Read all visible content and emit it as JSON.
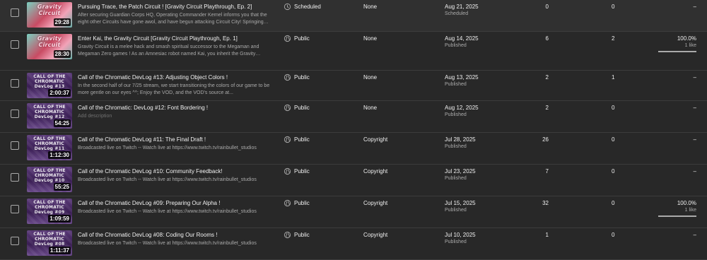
{
  "rows": [
    {
      "thumb_style": "gravity",
      "thumb_text": "Gravity Circuit",
      "duration": "29:28",
      "title": "Pursuing Trace, the Patch Circuit ! [Gravity Circuit Playthrough, Ep. 2]",
      "description": "After securing Guardian Corps HQ, Operating Commander Kernel informs you that the eight other Circuits have gone awol, and have begun attacking Circuit City! Springing into action,...",
      "visibility": "Scheduled",
      "visibility_icon": "clock-icon",
      "restrictions": "None",
      "date": "Aug 21, 2025",
      "date_status": "Scheduled",
      "views": "0",
      "comments": "0",
      "likes": "–",
      "likes_sub": "",
      "like_ratio": null
    },
    {
      "thumb_style": "gravity",
      "thumb_text": "Gravity Circuit",
      "duration": "28:30",
      "title": "Enter Kai, the Gravity Circuit [Gravity Circuit Playthrough, Ep. 1]",
      "description": "Gravity Circuit is a melee hack and smash spiritual successor to the Megaman and Megaman Zero games ! As an Amnesiac robot named Kai, you inherit the Gravity Circuit an...",
      "visibility": "Public",
      "visibility_icon": "globe-icon",
      "restrictions": "None",
      "date": "Aug 14, 2025",
      "date_status": "Published",
      "views": "6",
      "comments": "2",
      "likes": "100.0%",
      "likes_sub": "1 like",
      "like_ratio": 1.0
    },
    {
      "thumb_style": "chromatic",
      "thumb_text": "CALL OF THE CHROMATIC DevLog #13",
      "duration": "2:00:37",
      "title": "Call of the Chromatic DevLog #13: Adjusting Object Colors !",
      "description": "In the second half of our 7/25 stream, we start transitioning the colors of our game to be more gentle on our eyes ^^; Enjoy the VOD, and the VOD's source at...",
      "visibility": "Public",
      "visibility_icon": "globe-icon",
      "restrictions": "None",
      "date": "Aug 13, 2025",
      "date_status": "Published",
      "views": "2",
      "comments": "1",
      "likes": "–",
      "likes_sub": "",
      "like_ratio": null
    },
    {
      "thumb_style": "chromatic",
      "thumb_text": "CALL OF THE CHROMATIC DevLog #12",
      "duration": "54:25",
      "title": "Call of the Chromatic: DevLog #12: Font Bordering !",
      "description": "Add description",
      "description_placeholder": true,
      "visibility": "Public",
      "visibility_icon": "globe-icon",
      "restrictions": "None",
      "date": "Aug 12, 2025",
      "date_status": "Published",
      "views": "2",
      "comments": "0",
      "likes": "–",
      "likes_sub": "",
      "like_ratio": null
    },
    {
      "thumb_style": "chromatic",
      "thumb_text": "CALL OF THE CHROMATIC DevLog #11",
      "duration": "1:12:30",
      "title": "Call of the Chromatic DevLog #11: The Final Draft !",
      "description": "Broadcasted live on Twitch -- Watch live at https://www.twitch.tv/rainbullet_studios",
      "visibility": "Public",
      "visibility_icon": "globe-icon",
      "restrictions": "Copyright",
      "date": "Jul 28, 2025",
      "date_status": "Published",
      "views": "26",
      "comments": "0",
      "likes": "–",
      "likes_sub": "",
      "like_ratio": null
    },
    {
      "thumb_style": "chromatic",
      "thumb_text": "CALL OF THE CHROMATIC DevLog #10",
      "duration": "55:25",
      "title": "Call of the Chromatic DevLog #10: Community Feedback!",
      "description": "Broadcasted live on Twitch -- Watch live at https://www.twitch.tv/rainbullet_studios",
      "visibility": "Public",
      "visibility_icon": "globe-icon",
      "restrictions": "Copyright",
      "date": "Jul 23, 2025",
      "date_status": "Published",
      "views": "7",
      "comments": "0",
      "likes": "–",
      "likes_sub": "",
      "like_ratio": null
    },
    {
      "thumb_style": "chromatic",
      "thumb_text": "CALL OF THE CHROMATIC DevLog #09",
      "duration": "1:09:59",
      "title": "Call of the Chromatic DevLog #09: Preparing Our Alpha !",
      "description": "Broadcasted live on Twitch -- Watch live at https://www.twitch.tv/rainbullet_studios",
      "visibility": "Public",
      "visibility_icon": "globe-icon",
      "restrictions": "Copyright",
      "date": "Jul 15, 2025",
      "date_status": "Published",
      "views": "32",
      "comments": "0",
      "likes": "100.0%",
      "likes_sub": "1 like",
      "like_ratio": 1.0
    },
    {
      "thumb_style": "chromatic",
      "thumb_text": "CALL OF THE CHROMATIC DevLog #08",
      "duration": "1:11:37",
      "title": "Call of the Chromatic DevLog #08: Coding Our Rooms !",
      "description": "Broadcasted live on Twitch -- Watch live at https://www.twitch.tv/rainbullet_studios",
      "visibility": "Public",
      "visibility_icon": "globe-icon",
      "restrictions": "Copyright",
      "date": "Jul 10, 2025",
      "date_status": "Published",
      "views": "1",
      "comments": "0",
      "likes": "–",
      "likes_sub": "",
      "like_ratio": null
    }
  ]
}
